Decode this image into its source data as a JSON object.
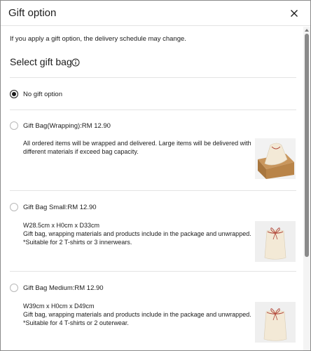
{
  "dialog": {
    "title": "Gift option",
    "close_icon": "close-icon",
    "note": "If you apply a gift option, the delivery schedule may change.",
    "section_title": "Select gift bag",
    "info_icon": "info-icon"
  },
  "options": [
    {
      "label": "No gift option",
      "selected": true
    },
    {
      "label": "Gift Bag(Wrapping):RM 12.90",
      "selected": false,
      "desc": [
        "All ordered items will be wrapped and delivered. Large items will be delivered with",
        "different materials if exceed bag capacity."
      ],
      "image": "gift-bag-in-box"
    },
    {
      "label": "Gift Bag Small:RM 12.90",
      "selected": false,
      "desc": [
        "W28.5cm x H0cm x D33cm",
        "Gift bag, wrapping materials and products include in the package and unwrapped.",
        "*Suitable for 2 T-shirts or 3 innerwears."
      ],
      "image": "drawstring-gift-bag"
    },
    {
      "label": "Gift Bag Medium:RM 12.90",
      "selected": false,
      "desc": [
        "W39cm x H0cm x D49cm",
        "Gift bag, wrapping materials and products include in the package and unwrapped.",
        "*Suitable for 4 T-shirts or 2 outerwear."
      ],
      "image": "drawstring-gift-bag"
    }
  ],
  "colors": {
    "text": "#1b1b1b",
    "divider": "#e3e3e3",
    "bag": "#f3e9d6",
    "ribbon": "#b24a3c",
    "box": "#c9965c"
  }
}
